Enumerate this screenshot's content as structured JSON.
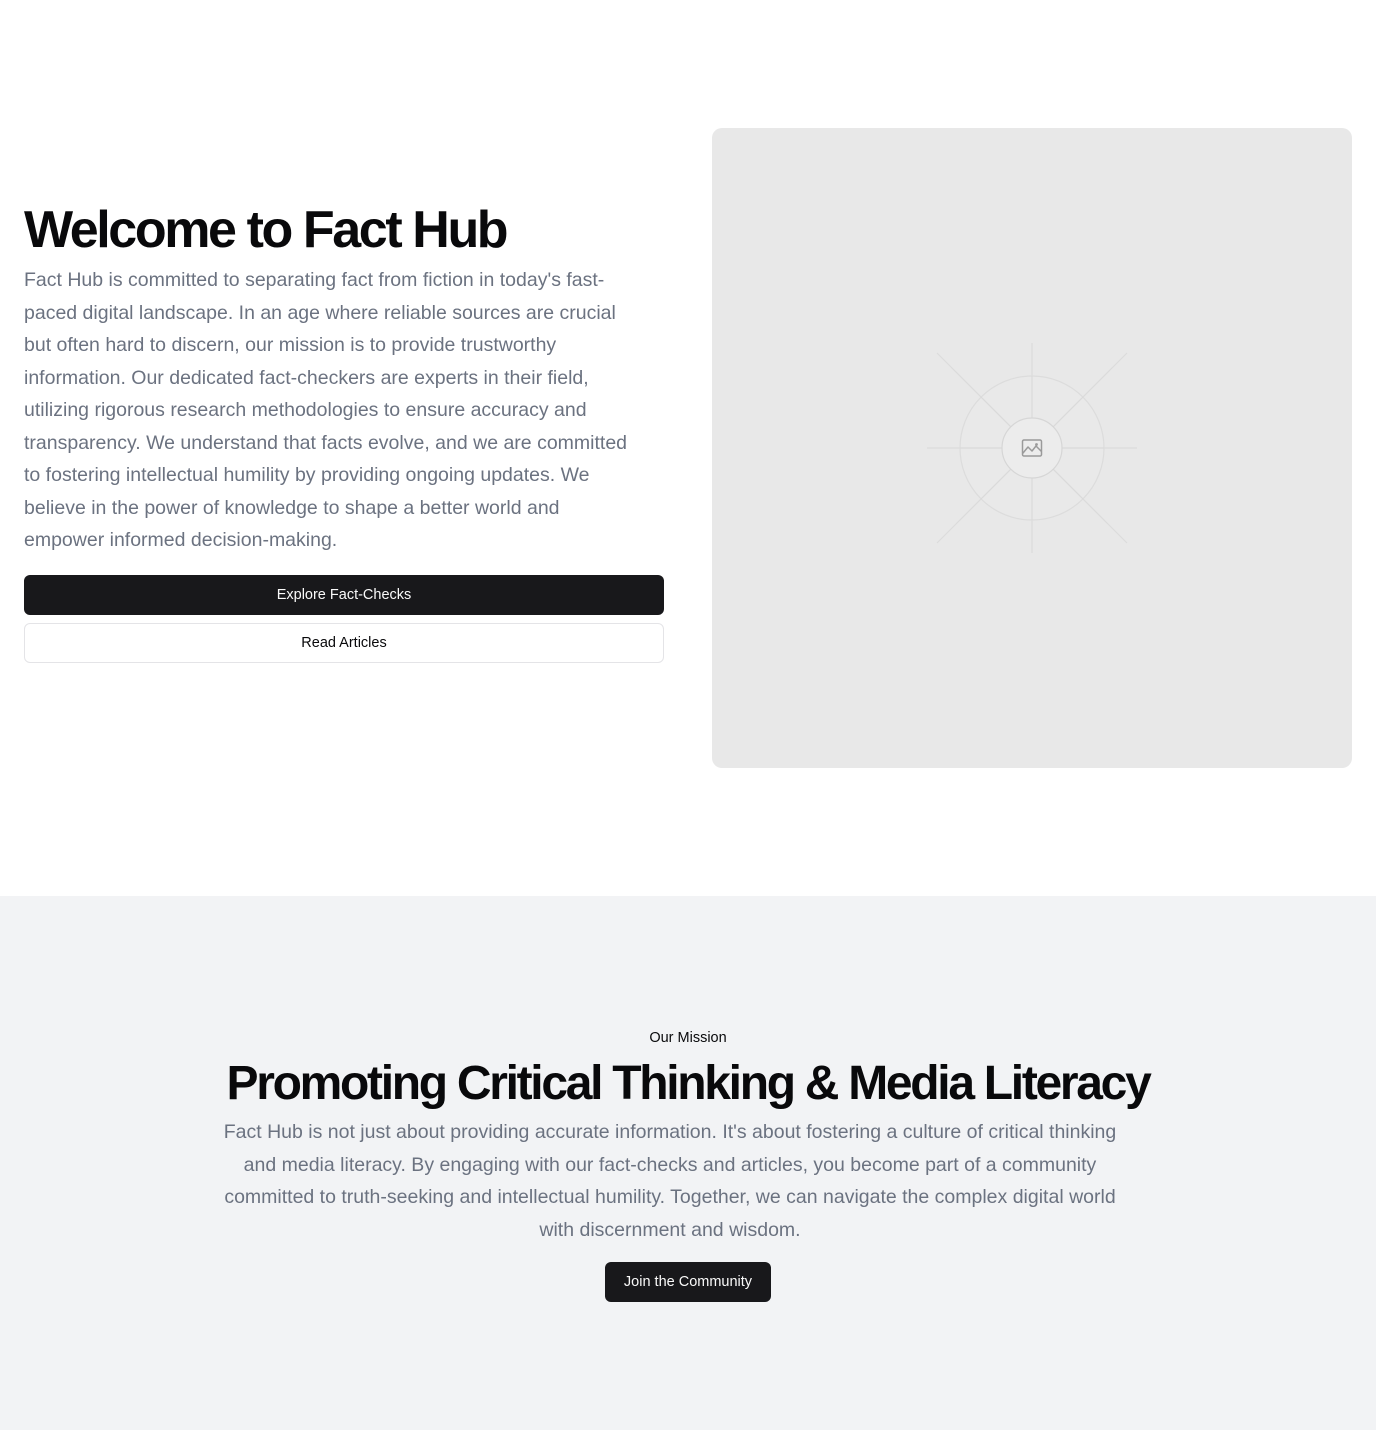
{
  "hero": {
    "title": "Welcome to Fact Hub",
    "description": "Fact Hub is committed to separating fact from fiction in today's fast-paced digital landscape. In an age where reliable sources are crucial but often hard to discern, our mission is to provide trustworthy information. Our dedicated fact-checkers are experts in their field, utilizing rigorous research methodologies to ensure accuracy and transparency. We understand that facts evolve, and we are committed to fostering intellectual humility by providing ongoing updates. We believe in the power of knowledge to shape a better world and empower informed decision-making.",
    "primary_button": "Explore Fact-Checks",
    "secondary_button": "Read Articles",
    "image_icon": "image-placeholder-icon"
  },
  "mission": {
    "eyebrow": "Our Mission",
    "title": "Promoting Critical Thinking & Media Literacy",
    "description": "Fact Hub is not just about providing accurate information. It's about fostering a culture of critical thinking and media literacy. By engaging with our fact-checks and articles, you become part of a community committed to truth-seeking and intellectual humility. Together, we can navigate the complex digital world with discernment and wisdom.",
    "button": "Join the Community"
  },
  "colors": {
    "primary_button_bg": "#18181b",
    "muted_text": "#6b7280",
    "mission_bg": "#f2f3f5",
    "placeholder_bg": "#e8e8e8"
  }
}
